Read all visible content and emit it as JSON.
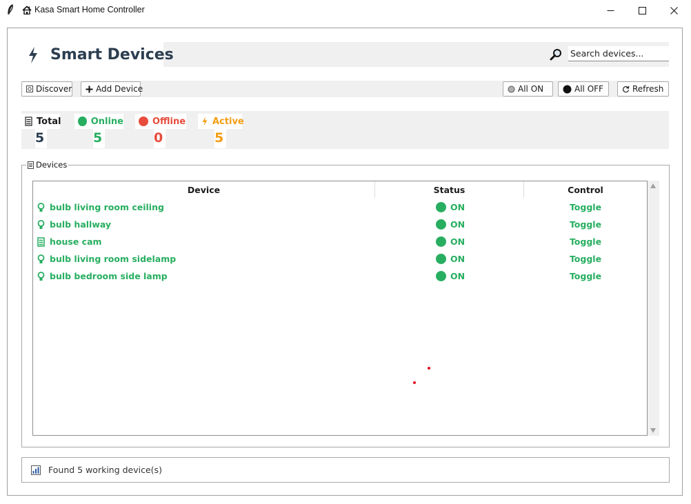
{
  "window": {
    "title": "Kasa Smart Home Controller",
    "feather_icon": "feather-icon",
    "title_icon": "house-icon",
    "controls": [
      "minimize",
      "maximize",
      "close"
    ]
  },
  "header": {
    "icon": "lightning-bolt-icon",
    "title": "Smart Devices",
    "search": {
      "icon": "magnifier-icon",
      "value": "Search devices..."
    }
  },
  "toolbar": {
    "discover_label": "Discover",
    "add_device_label": "Add Device",
    "all_on_label": "All ON",
    "all_off_label": "All OFF",
    "refresh_label": "Refresh"
  },
  "stats": {
    "total": {
      "label": "Total",
      "value": "5",
      "icon": "device-stack-icon"
    },
    "online": {
      "label": "Online",
      "value": "5",
      "icon": "green-circle-icon",
      "color": "#27ae60"
    },
    "offline": {
      "label": "Offline",
      "value": "0",
      "icon": "red-circle-icon",
      "color": "#e74c3c"
    },
    "active": {
      "label": "Active",
      "value": "5",
      "icon": "lightning-bolt-icon",
      "color": "#f39c12"
    }
  },
  "devices_panel": {
    "title": "Devices",
    "columns": [
      "Device",
      "Status",
      "Control"
    ],
    "rows": [
      {
        "name": "bulb living room ceiling",
        "icon": "bulb-icon",
        "status": "ON",
        "control": "Toggle"
      },
      {
        "name": "bulb hallway",
        "icon": "bulb-icon",
        "status": "ON",
        "control": "Toggle"
      },
      {
        "name": "house cam",
        "icon": "camera-icon",
        "status": "ON",
        "control": "Toggle"
      },
      {
        "name": "bulb living room sidelamp",
        "icon": "bulb-icon",
        "status": "ON",
        "control": "Toggle"
      },
      {
        "name": "bulb bedroom side lamp",
        "icon": "bulb-icon",
        "status": "ON",
        "control": "Toggle"
      }
    ]
  },
  "status_bar": {
    "icon": "bar-chart-icon",
    "text": "Found 5 working device(s)"
  },
  "colors": {
    "accent_green": "#27ae60",
    "offline_red": "#e74c3c",
    "active_orange": "#f39c12",
    "title_dark": "#2c3e50"
  }
}
